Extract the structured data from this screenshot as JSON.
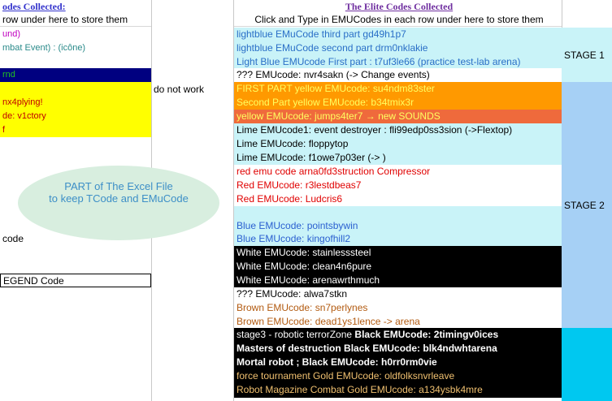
{
  "left": {
    "header": "odes Collected:",
    "subheader": " row under here to store them",
    "rows": [
      {
        "text": "und)",
        "color": "#c000c0",
        "bg": ""
      },
      {
        "text": "mbat Event) : (icône)",
        "color": "#2a8a8a",
        "bg": ""
      },
      {
        "text": "",
        "color": "",
        "bg": ""
      },
      {
        "text": "rnd",
        "color": "#20c020",
        "bg": "#000080"
      },
      {
        "text": "",
        "color": "#c00000",
        "bg": "#ffff00"
      },
      {
        "text": "nx4plying!",
        "color": "#c00000",
        "bg": "#ffff00"
      },
      {
        "text": "de: v1ctory",
        "color": "#c00000",
        "bg": "#ffff00"
      },
      {
        "text": "f",
        "color": "#c00000",
        "bg": "#ffff00"
      },
      {
        "text": "code",
        "color": "#000000",
        "bg": ""
      },
      {
        "text": "EGEND Code",
        "color": "#000000",
        "bg": ""
      }
    ],
    "note": "do not work"
  },
  "ellipse": {
    "line1": "PART of The Excel File",
    "line2": "to keep TCode and EMuCode"
  },
  "right": {
    "header": "The Elite Codes Collected",
    "subheader": "Click and Type in EMUCodes in each row under here to store them",
    "rows": [
      {
        "text": "lightblue EMuCode third part gd49h1p7",
        "color": "#2a6fc7",
        "bg": "#c9f3f8",
        "bold": false
      },
      {
        "text": "lightblue EMuCode second part drm0nklakie",
        "color": "#2a6fc7",
        "bg": "#c9f3f8",
        "bold": false
      },
      {
        "text": "Light Blue EMUcode First part : t7uf3le66 (practice test-lab arena)",
        "color": "#2a6fc7",
        "bg": "#c9f3f8",
        "bold": false
      },
      {
        "text": "??? EMUcode: nvr4sakn (-> Change events)",
        "color": "#000000",
        "bg": "#ffffff",
        "bold": false
      },
      {
        "text": "FIRST PART yellow EMUcode: su4ndm83ster",
        "color": "#ffff60",
        "bg": "#ff9900",
        "bold": false
      },
      {
        "text": "Second Part yellow EMUcode: b34tmix3r",
        "color": "#ffff60",
        "bg": "#ff9900",
        "bold": false
      },
      {
        "text": "yellow EMUcode: jumps4ter7  → new SOUNDS",
        "color": "#ffff60",
        "bg": "#ef6a3c",
        "bold": false
      },
      {
        "text": "Lime EMUcode1: event destroyer : fli99edp0ss3sion (->Flextop)",
        "color": "#000000",
        "bg": "#c9f3f8",
        "bold": false
      },
      {
        "text": "Lime EMUcode: floppytop",
        "color": "#000000",
        "bg": "#c9f3f8",
        "bold": false
      },
      {
        "text": "Lime EMUcode: f1owe7p03er (-> )",
        "color": "#000000",
        "bg": "#c9f3f8",
        "bold": false
      },
      {
        "text": "red emu code arna0fd3struction Compressor",
        "color": "#e00000",
        "bg": "#ffffff",
        "bold": false
      },
      {
        "text": "Red EMUcode: r3lestdbeas7",
        "color": "#e00000",
        "bg": "#ffffff",
        "bold": false
      },
      {
        "text": "Red EMUcode: Ludcris6",
        "color": "#e00000",
        "bg": "#ffffff",
        "bold": false
      },
      {
        "text": "Blue EMUcode: pointsbywin",
        "color": "#2a5fd0",
        "bg": "#c9f3f8",
        "bold": false
      },
      {
        "text": "Blue EMUcode: kingofhill2",
        "color": "#2a5fd0",
        "bg": "#c9f3f8",
        "bold": false
      },
      {
        "text": " White EMUcode: stainlesssteel",
        "color": "#ffffff",
        "bg": "#000000",
        "bold": false
      },
      {
        "text": "White EMUcode: clean4n6pure",
        "color": "#ffffff",
        "bg": "#000000",
        "bold": false
      },
      {
        "text": "White EMUcode: arenawrthmuch",
        "color": "#ffffff",
        "bg": "#000000",
        "bold": false
      },
      {
        "text": "??? EMUcode: alwa7stkn",
        "color": "#000000",
        "bg": "#ffffff",
        "bold": false
      },
      {
        "text": "Brown EMUcode: sn7perlynes",
        "color": "#b25a10",
        "bg": "#ffffff",
        "bold": false
      },
      {
        "text": "Brown EMUcode: dead1ys1lence -> arena",
        "color": "#b25a10",
        "bg": "#ffffff",
        "bold": false
      },
      {
        "text": "stage3 - robotic terrorZone ",
        "bold_text": "Black EMUcode: 2timingv0ices",
        "color": "#ffffff",
        "bg": "#000000",
        "bold": false
      },
      {
        "text": "Masters of  destruction Black EMUcode: blk4ndwhtarena",
        "color": "#ffffff",
        "bg": "#000000",
        "bold": true
      },
      {
        "text": "Mortal robot ; Black EMUcode: h0rr0rm0vie",
        "color": "#ffffff",
        "bg": "#000000",
        "bold": true
      },
      {
        "text": "force tournament Gold EMUcode: oldfolksnvrleave",
        "color": "#f0c070",
        "bg": "#000000",
        "bold": false
      },
      {
        "text": "Robot Magazine Combat Gold EMUcode: a134ysbk4mre",
        "color": "#f0c070",
        "bg": "#000000",
        "bold": false
      }
    ]
  },
  "stages": [
    {
      "label": "STAGE 1",
      "bg": "#c9f3f8"
    },
    {
      "label": "STAGE 2",
      "bg": "#a6d0f5"
    },
    {
      "label": "",
      "bg": "#00c8f0"
    }
  ]
}
